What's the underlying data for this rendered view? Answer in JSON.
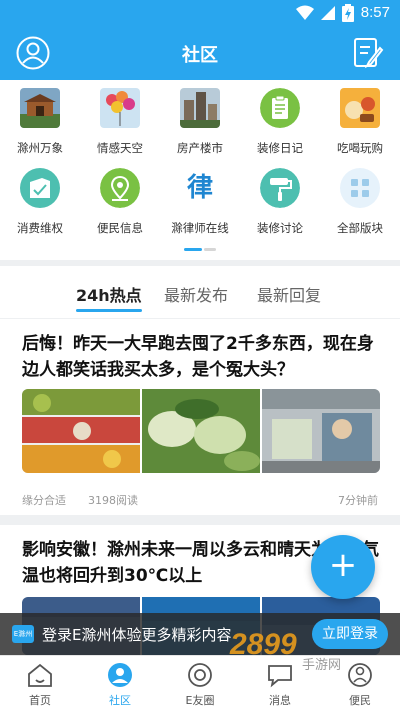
{
  "status": {
    "time": "8:57"
  },
  "header": {
    "title": "社区",
    "avatar_icon": "user-avatar-icon",
    "edit_icon": "edit-note-icon"
  },
  "categories": [
    {
      "label": "滁州万象",
      "icon": "pavilion-photo"
    },
    {
      "label": "情感天空",
      "icon": "balloons-photo"
    },
    {
      "label": "房产楼市",
      "icon": "buildings-photo"
    },
    {
      "label": "装修日记",
      "icon": "clipboard-icon"
    },
    {
      "label": "吃喝玩购",
      "icon": "food-photo"
    },
    {
      "label": "消费维权",
      "icon": "shield-doc-icon"
    },
    {
      "label": "便民信息",
      "icon": "location-pin-icon"
    },
    {
      "label": "滁律师在线",
      "icon": "law-glyph-icon",
      "glyph": "律"
    },
    {
      "label": "装修讨论",
      "icon": "paint-roller-icon"
    },
    {
      "label": "全部版块",
      "icon": "grid-icon"
    }
  ],
  "tabs": [
    {
      "label": "24h热点",
      "active": true
    },
    {
      "label": "最新发布",
      "active": false
    },
    {
      "label": "最新回复",
      "active": false
    }
  ],
  "posts": [
    {
      "title": "后悔！昨天一大早跑去囤了2千多东西，现在身边人都笑话我买太多，是个冤大头？",
      "author": "缘分合适",
      "reads": "3198阅读",
      "time": "7分钟前"
    },
    {
      "title": "影响安徽！滁州未来一周以多云和晴天为主，气温也将回升到30℃以上"
    }
  ],
  "fab": {
    "label": "+"
  },
  "login_banner": {
    "logo_text": "E滁州",
    "text": "登录E滁州体验更多精彩内容",
    "button": "立即登录"
  },
  "bottom_nav": [
    {
      "label": "首页",
      "icon": "home-icon",
      "active": false
    },
    {
      "label": "社区",
      "icon": "community-icon",
      "active": true
    },
    {
      "label": "E友圈",
      "icon": "friends-circle-icon",
      "active": false
    },
    {
      "label": "消息",
      "icon": "message-icon",
      "active": false
    },
    {
      "label": "便民",
      "icon": "services-icon",
      "active": false
    }
  ],
  "watermark": {
    "number": "2899",
    "text": "手游网"
  },
  "colors": {
    "primary": "#29a6ee",
    "green": "#7ac143",
    "teal": "#4dbfb0"
  }
}
